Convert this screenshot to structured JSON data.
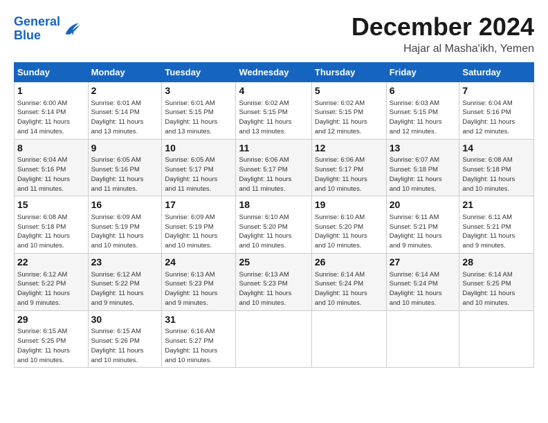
{
  "logo": {
    "line1": "General",
    "line2": "Blue"
  },
  "header": {
    "month": "December 2024",
    "location": "Hajar al Masha'ikh, Yemen"
  },
  "days_of_week": [
    "Sunday",
    "Monday",
    "Tuesday",
    "Wednesday",
    "Thursday",
    "Friday",
    "Saturday"
  ],
  "weeks": [
    [
      {
        "day": "1",
        "info": "Sunrise: 6:00 AM\nSunset: 5:14 PM\nDaylight: 11 hours\nand 14 minutes."
      },
      {
        "day": "2",
        "info": "Sunrise: 6:01 AM\nSunset: 5:14 PM\nDaylight: 11 hours\nand 13 minutes."
      },
      {
        "day": "3",
        "info": "Sunrise: 6:01 AM\nSunset: 5:15 PM\nDaylight: 11 hours\nand 13 minutes."
      },
      {
        "day": "4",
        "info": "Sunrise: 6:02 AM\nSunset: 5:15 PM\nDaylight: 11 hours\nand 13 minutes."
      },
      {
        "day": "5",
        "info": "Sunrise: 6:02 AM\nSunset: 5:15 PM\nDaylight: 11 hours\nand 12 minutes."
      },
      {
        "day": "6",
        "info": "Sunrise: 6:03 AM\nSunset: 5:15 PM\nDaylight: 11 hours\nand 12 minutes."
      },
      {
        "day": "7",
        "info": "Sunrise: 6:04 AM\nSunset: 5:16 PM\nDaylight: 11 hours\nand 12 minutes."
      }
    ],
    [
      {
        "day": "8",
        "info": "Sunrise: 6:04 AM\nSunset: 5:16 PM\nDaylight: 11 hours\nand 11 minutes."
      },
      {
        "day": "9",
        "info": "Sunrise: 6:05 AM\nSunset: 5:16 PM\nDaylight: 11 hours\nand 11 minutes."
      },
      {
        "day": "10",
        "info": "Sunrise: 6:05 AM\nSunset: 5:17 PM\nDaylight: 11 hours\nand 11 minutes."
      },
      {
        "day": "11",
        "info": "Sunrise: 6:06 AM\nSunset: 5:17 PM\nDaylight: 11 hours\nand 11 minutes."
      },
      {
        "day": "12",
        "info": "Sunrise: 6:06 AM\nSunset: 5:17 PM\nDaylight: 11 hours\nand 10 minutes."
      },
      {
        "day": "13",
        "info": "Sunrise: 6:07 AM\nSunset: 5:18 PM\nDaylight: 11 hours\nand 10 minutes."
      },
      {
        "day": "14",
        "info": "Sunrise: 6:08 AM\nSunset: 5:18 PM\nDaylight: 11 hours\nand 10 minutes."
      }
    ],
    [
      {
        "day": "15",
        "info": "Sunrise: 6:08 AM\nSunset: 5:18 PM\nDaylight: 11 hours\nand 10 minutes."
      },
      {
        "day": "16",
        "info": "Sunrise: 6:09 AM\nSunset: 5:19 PM\nDaylight: 11 hours\nand 10 minutes."
      },
      {
        "day": "17",
        "info": "Sunrise: 6:09 AM\nSunset: 5:19 PM\nDaylight: 11 hours\nand 10 minutes."
      },
      {
        "day": "18",
        "info": "Sunrise: 6:10 AM\nSunset: 5:20 PM\nDaylight: 11 hours\nand 10 minutes."
      },
      {
        "day": "19",
        "info": "Sunrise: 6:10 AM\nSunset: 5:20 PM\nDaylight: 11 hours\nand 10 minutes."
      },
      {
        "day": "20",
        "info": "Sunrise: 6:11 AM\nSunset: 5:21 PM\nDaylight: 11 hours\nand 9 minutes."
      },
      {
        "day": "21",
        "info": "Sunrise: 6:11 AM\nSunset: 5:21 PM\nDaylight: 11 hours\nand 9 minutes."
      }
    ],
    [
      {
        "day": "22",
        "info": "Sunrise: 6:12 AM\nSunset: 5:22 PM\nDaylight: 11 hours\nand 9 minutes."
      },
      {
        "day": "23",
        "info": "Sunrise: 6:12 AM\nSunset: 5:22 PM\nDaylight: 11 hours\nand 9 minutes."
      },
      {
        "day": "24",
        "info": "Sunrise: 6:13 AM\nSunset: 5:23 PM\nDaylight: 11 hours\nand 9 minutes."
      },
      {
        "day": "25",
        "info": "Sunrise: 6:13 AM\nSunset: 5:23 PM\nDaylight: 11 hours\nand 10 minutes."
      },
      {
        "day": "26",
        "info": "Sunrise: 6:14 AM\nSunset: 5:24 PM\nDaylight: 11 hours\nand 10 minutes."
      },
      {
        "day": "27",
        "info": "Sunrise: 6:14 AM\nSunset: 5:24 PM\nDaylight: 11 hours\nand 10 minutes."
      },
      {
        "day": "28",
        "info": "Sunrise: 6:14 AM\nSunset: 5:25 PM\nDaylight: 11 hours\nand 10 minutes."
      }
    ],
    [
      {
        "day": "29",
        "info": "Sunrise: 6:15 AM\nSunset: 5:25 PM\nDaylight: 11 hours\nand 10 minutes."
      },
      {
        "day": "30",
        "info": "Sunrise: 6:15 AM\nSunset: 5:26 PM\nDaylight: 11 hours\nand 10 minutes."
      },
      {
        "day": "31",
        "info": "Sunrise: 6:16 AM\nSunset: 5:27 PM\nDaylight: 11 hours\nand 10 minutes."
      },
      {
        "day": "",
        "info": ""
      },
      {
        "day": "",
        "info": ""
      },
      {
        "day": "",
        "info": ""
      },
      {
        "day": "",
        "info": ""
      }
    ]
  ]
}
